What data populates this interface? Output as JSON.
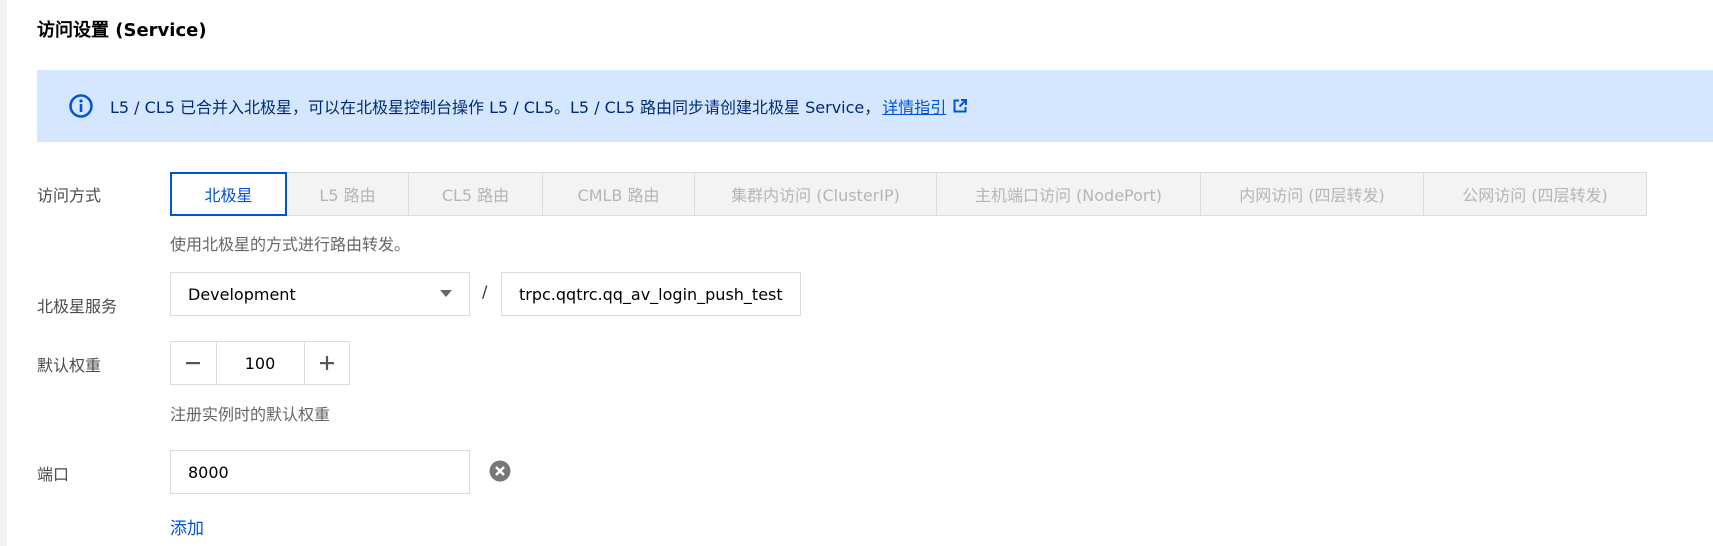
{
  "section": {
    "title": "访问设置 (Service)"
  },
  "notice": {
    "text": "L5 / CL5 已合并入北极星，可以在北极星控制台操作 L5 / CL5。L5 / CL5 路由同步请创建北极星 Service，",
    "link_label": "详情指引",
    "icon": "info-circle-icon",
    "link_icon": "external-link-icon"
  },
  "access_mode": {
    "label": "访问方式",
    "tabs": [
      {
        "label": "北极星",
        "active": true
      },
      {
        "label": "L5 路由",
        "active": false
      },
      {
        "label": "CL5 路由",
        "active": false
      },
      {
        "label": "CMLB 路由",
        "active": false
      },
      {
        "label": "集群内访问 (ClusterIP)",
        "active": false
      },
      {
        "label": "主机端口访问 (NodePort)",
        "active": false
      },
      {
        "label": "内网访问 (四层转发)",
        "active": false
      },
      {
        "label": "公网访问 (四层转发)",
        "active": false
      }
    ],
    "help": "使用北极星的方式进行路由转发。"
  },
  "polaris_service": {
    "label": "北极星服务",
    "env_value": "Development",
    "separator": "/",
    "name_value": "trpc.qqtrc.qq_av_login_push_test"
  },
  "weight": {
    "label": "默认权重",
    "value": "100",
    "help": "注册实例时的默认权重"
  },
  "port": {
    "label": "端口",
    "value": "8000",
    "add_label": "添加"
  },
  "colors": {
    "accent": "#0052d9",
    "notice_bg": "#d5e7ff",
    "notice_text": "#002a7a",
    "border": "#dcdcdc",
    "disabled_tab_bg": "#f3f3f3",
    "disabled_tab_text": "#b5b5b5"
  }
}
